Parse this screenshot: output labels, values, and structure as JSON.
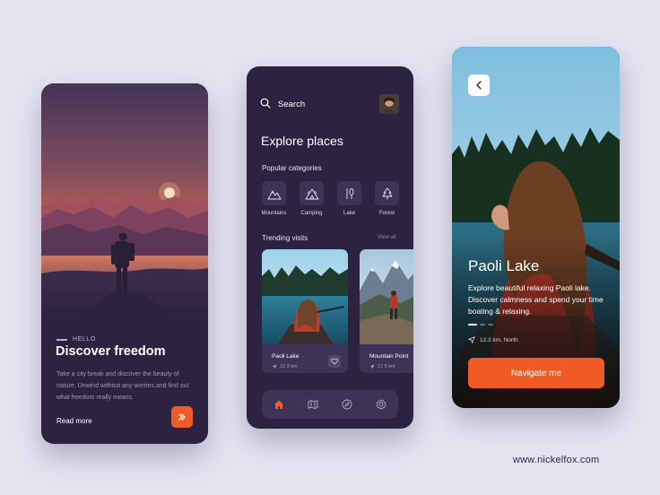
{
  "screen1": {
    "hello": "HELLO",
    "title": "Discover freedom",
    "description": "Take a city break and discover the beauty of nature. Unwind without any worries and find out what freedom really means.",
    "read_more": "Read more",
    "next_icon": "double-chevron-right-icon"
  },
  "screen2": {
    "search_label": "Search",
    "heading": "Explore places",
    "popular_categories": "Popular categories",
    "categories": [
      {
        "label": "Mountains",
        "icon": "mountains-icon"
      },
      {
        "label": "Camping",
        "icon": "tent-icon"
      },
      {
        "label": "Lake",
        "icon": "canoe-paddle-icon"
      },
      {
        "label": "Forest",
        "icon": "tree-icon"
      }
    ],
    "trending_visits": "Trending visits",
    "view_all": "View all",
    "trending": [
      {
        "name": "Paoli Lake",
        "distance": "12.3 km"
      },
      {
        "name": "Mountain Point",
        "distance": "17.5 km"
      }
    ],
    "nav_items": [
      "home-icon",
      "map-icon",
      "compass-icon",
      "settings-icon"
    ],
    "accent": "#f05a24"
  },
  "screen3": {
    "title": "Paoli Lake",
    "description": "Explore beautiful relaxing Paoli lake. Discover calmness and spend your time boating & relaxing.",
    "location": "12.3 km, North",
    "navigate": "Navigate me"
  },
  "brand": "www.nickelfox.com"
}
